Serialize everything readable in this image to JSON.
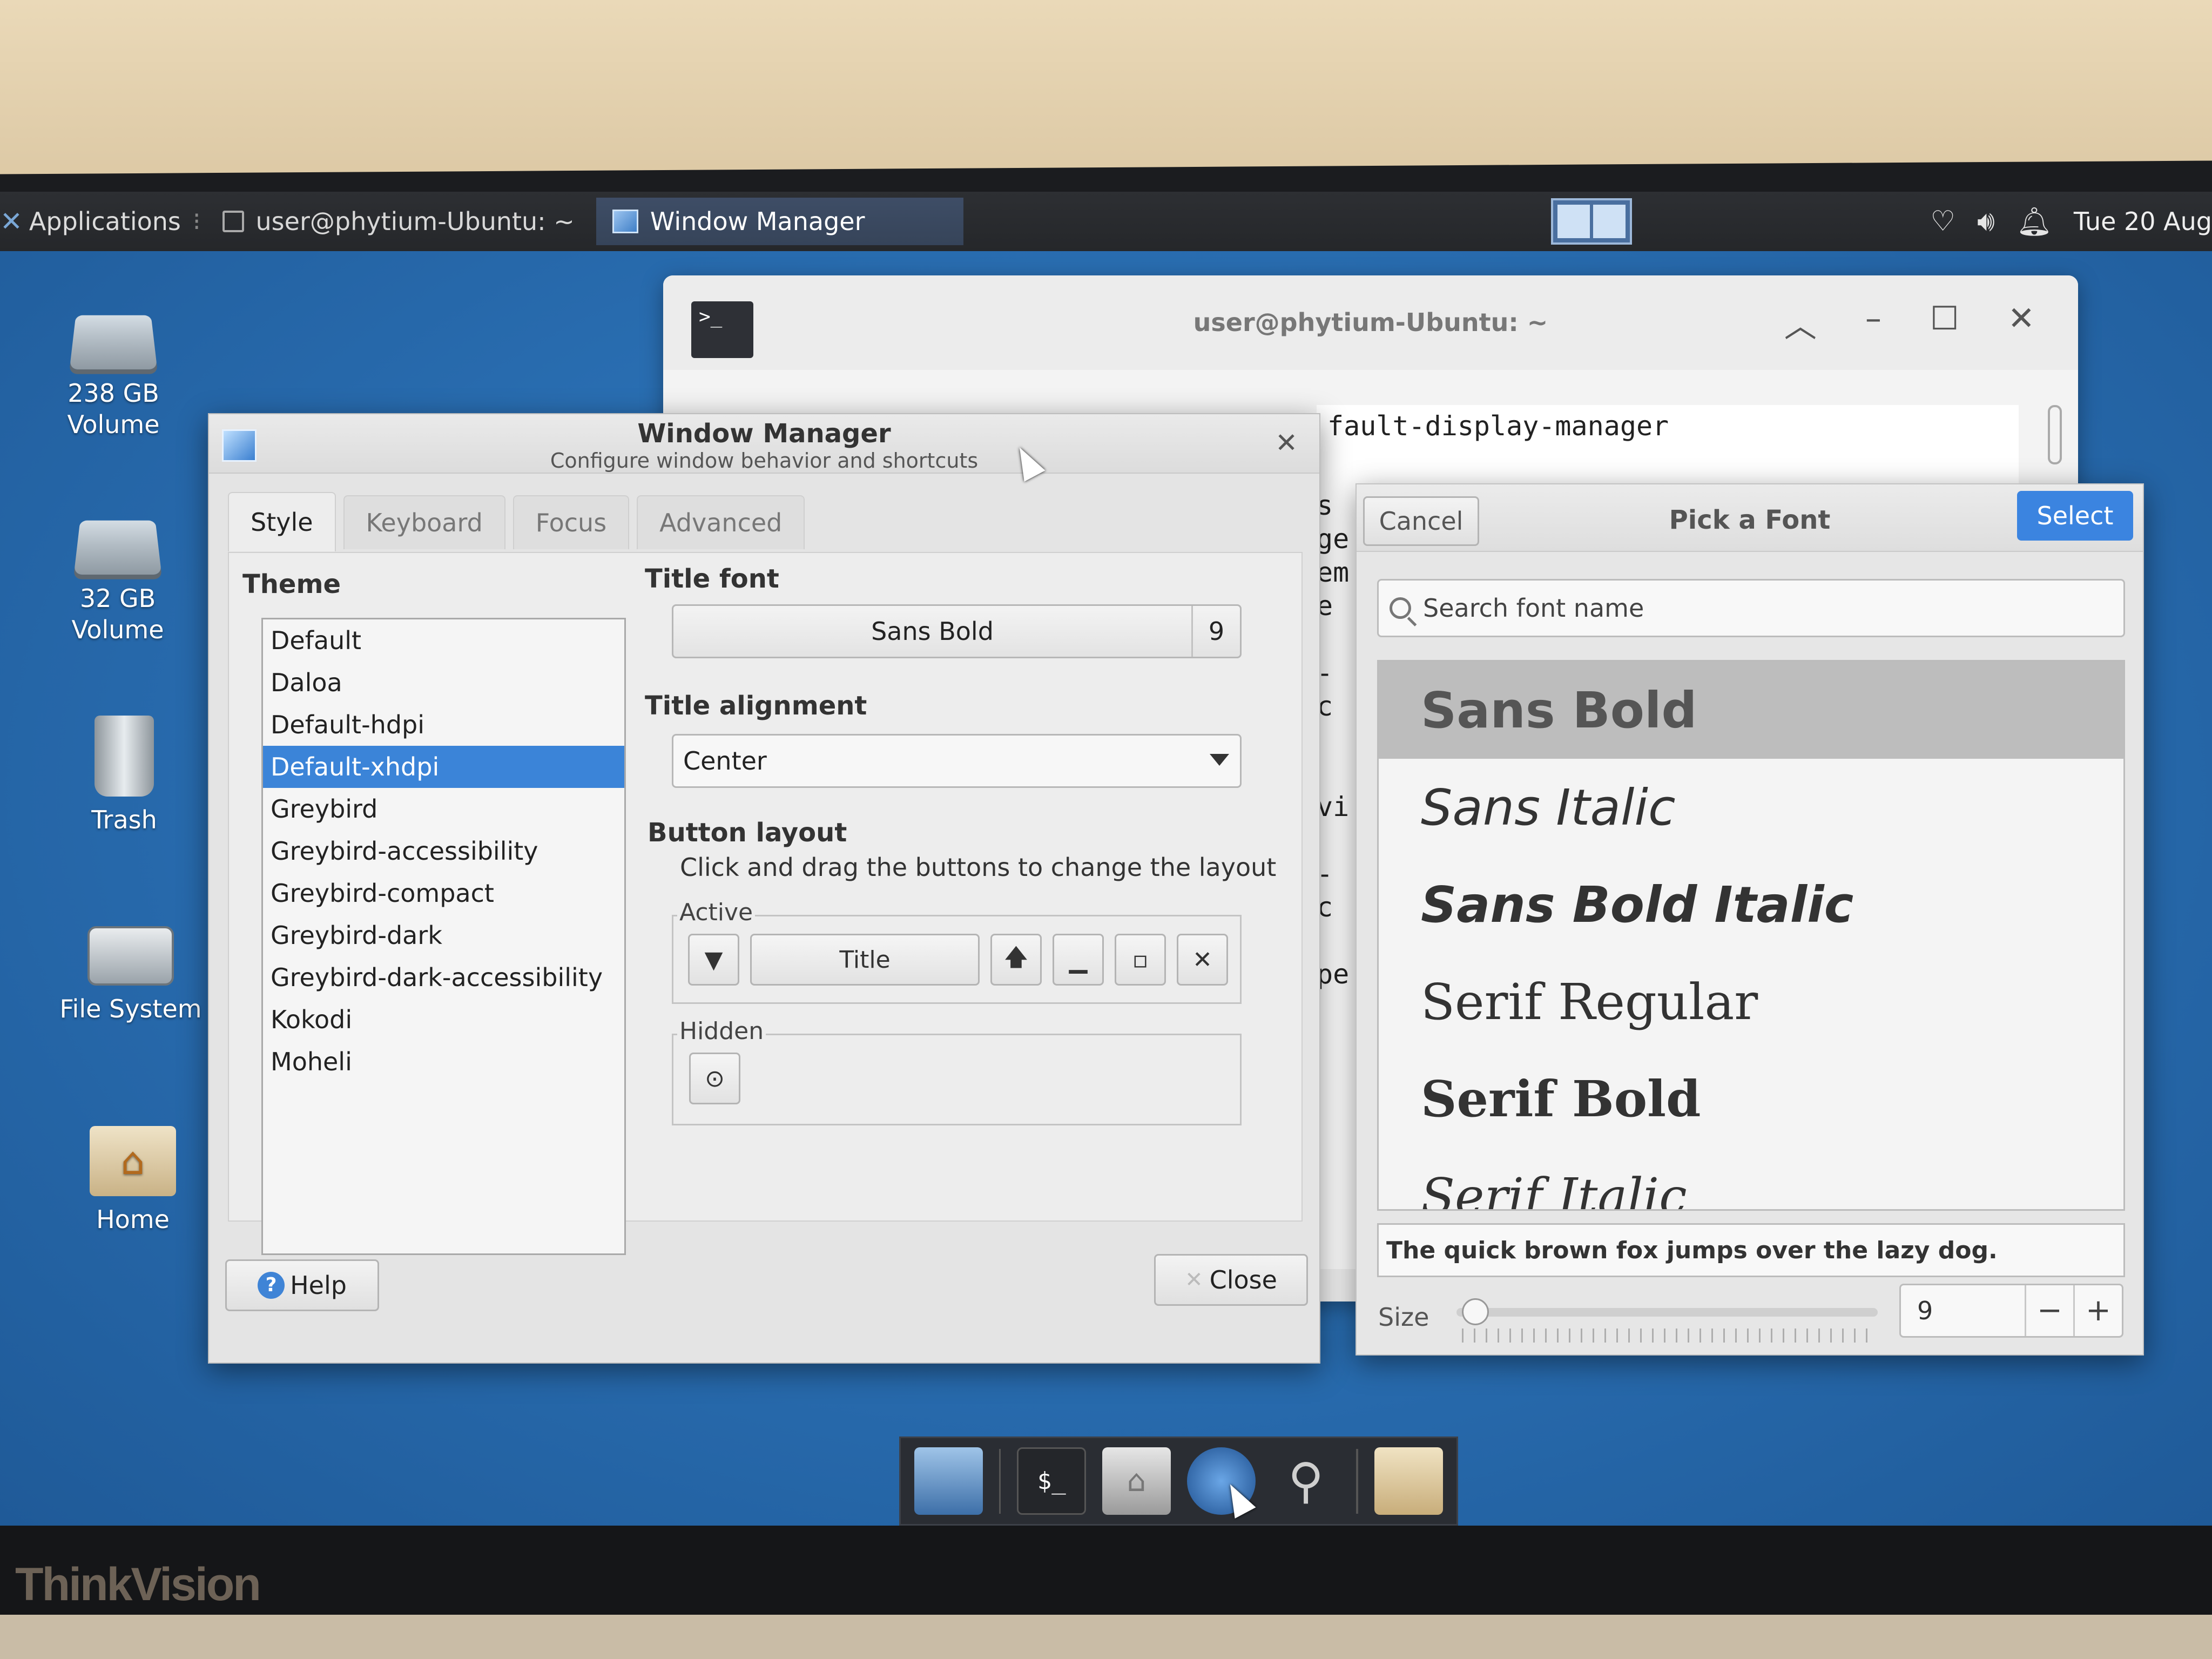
{
  "panel": {
    "applications": "Applications",
    "tasks": [
      {
        "label": "user@phytium-Ubuntu: ~"
      },
      {
        "label": "Window Manager"
      }
    ],
    "clock": "Tue 20 Aug"
  },
  "desktop_icons": [
    {
      "label": "238 GB\nVolume"
    },
    {
      "label": "32 GB\nVolume"
    },
    {
      "label": "Trash"
    },
    {
      "label": "File System"
    },
    {
      "label": "Home"
    }
  ],
  "terminal": {
    "title": "user@phytium-Ubuntu: ~",
    "lines": [
      "fault-display-manager",
      "s",
      "ge",
      "em",
      "e",
      "",
      "-c",
      "",
      "",
      "vi",
      "",
      "-c",
      "",
      "pe"
    ]
  },
  "window_manager": {
    "title": "Window Manager",
    "subtitle": "Configure window behavior and shortcuts",
    "tabs": [
      "Style",
      "Keyboard",
      "Focus",
      "Advanced"
    ],
    "theme_label": "Theme",
    "themes": [
      "Default",
      "Daloa",
      "Default-hdpi",
      "Default-xhdpi",
      "Greybird",
      "Greybird-accessibility",
      "Greybird-compact",
      "Greybird-dark",
      "Greybird-dark-accessibility",
      "Kokodi",
      "Moheli"
    ],
    "selected_theme": "Default-xhdpi",
    "title_font_label": "Title font",
    "title_font_name": "Sans Bold",
    "title_font_size": "9",
    "title_alignment_label": "Title alignment",
    "title_alignment_value": "Center",
    "button_layout_label": "Button layout",
    "button_layout_hint": "Click and drag the buttons to change the layout",
    "active_label": "Active",
    "hidden_label": "Hidden",
    "title_button": "Title",
    "help": "Help",
    "close": "Close"
  },
  "font_picker": {
    "title": "Pick a Font",
    "cancel": "Cancel",
    "select": "Select",
    "search_placeholder": "Search font name",
    "fonts": [
      "Sans Bold",
      "Sans Italic",
      "Sans Bold Italic",
      "Serif Regular",
      "Serif Bold",
      "Serif Italic"
    ],
    "selected_font": "Sans Bold",
    "preview_text": "The quick brown fox jumps over the lazy dog.",
    "size_label": "Size",
    "size_value": "9"
  },
  "monitor_brand": "ThinkVision"
}
